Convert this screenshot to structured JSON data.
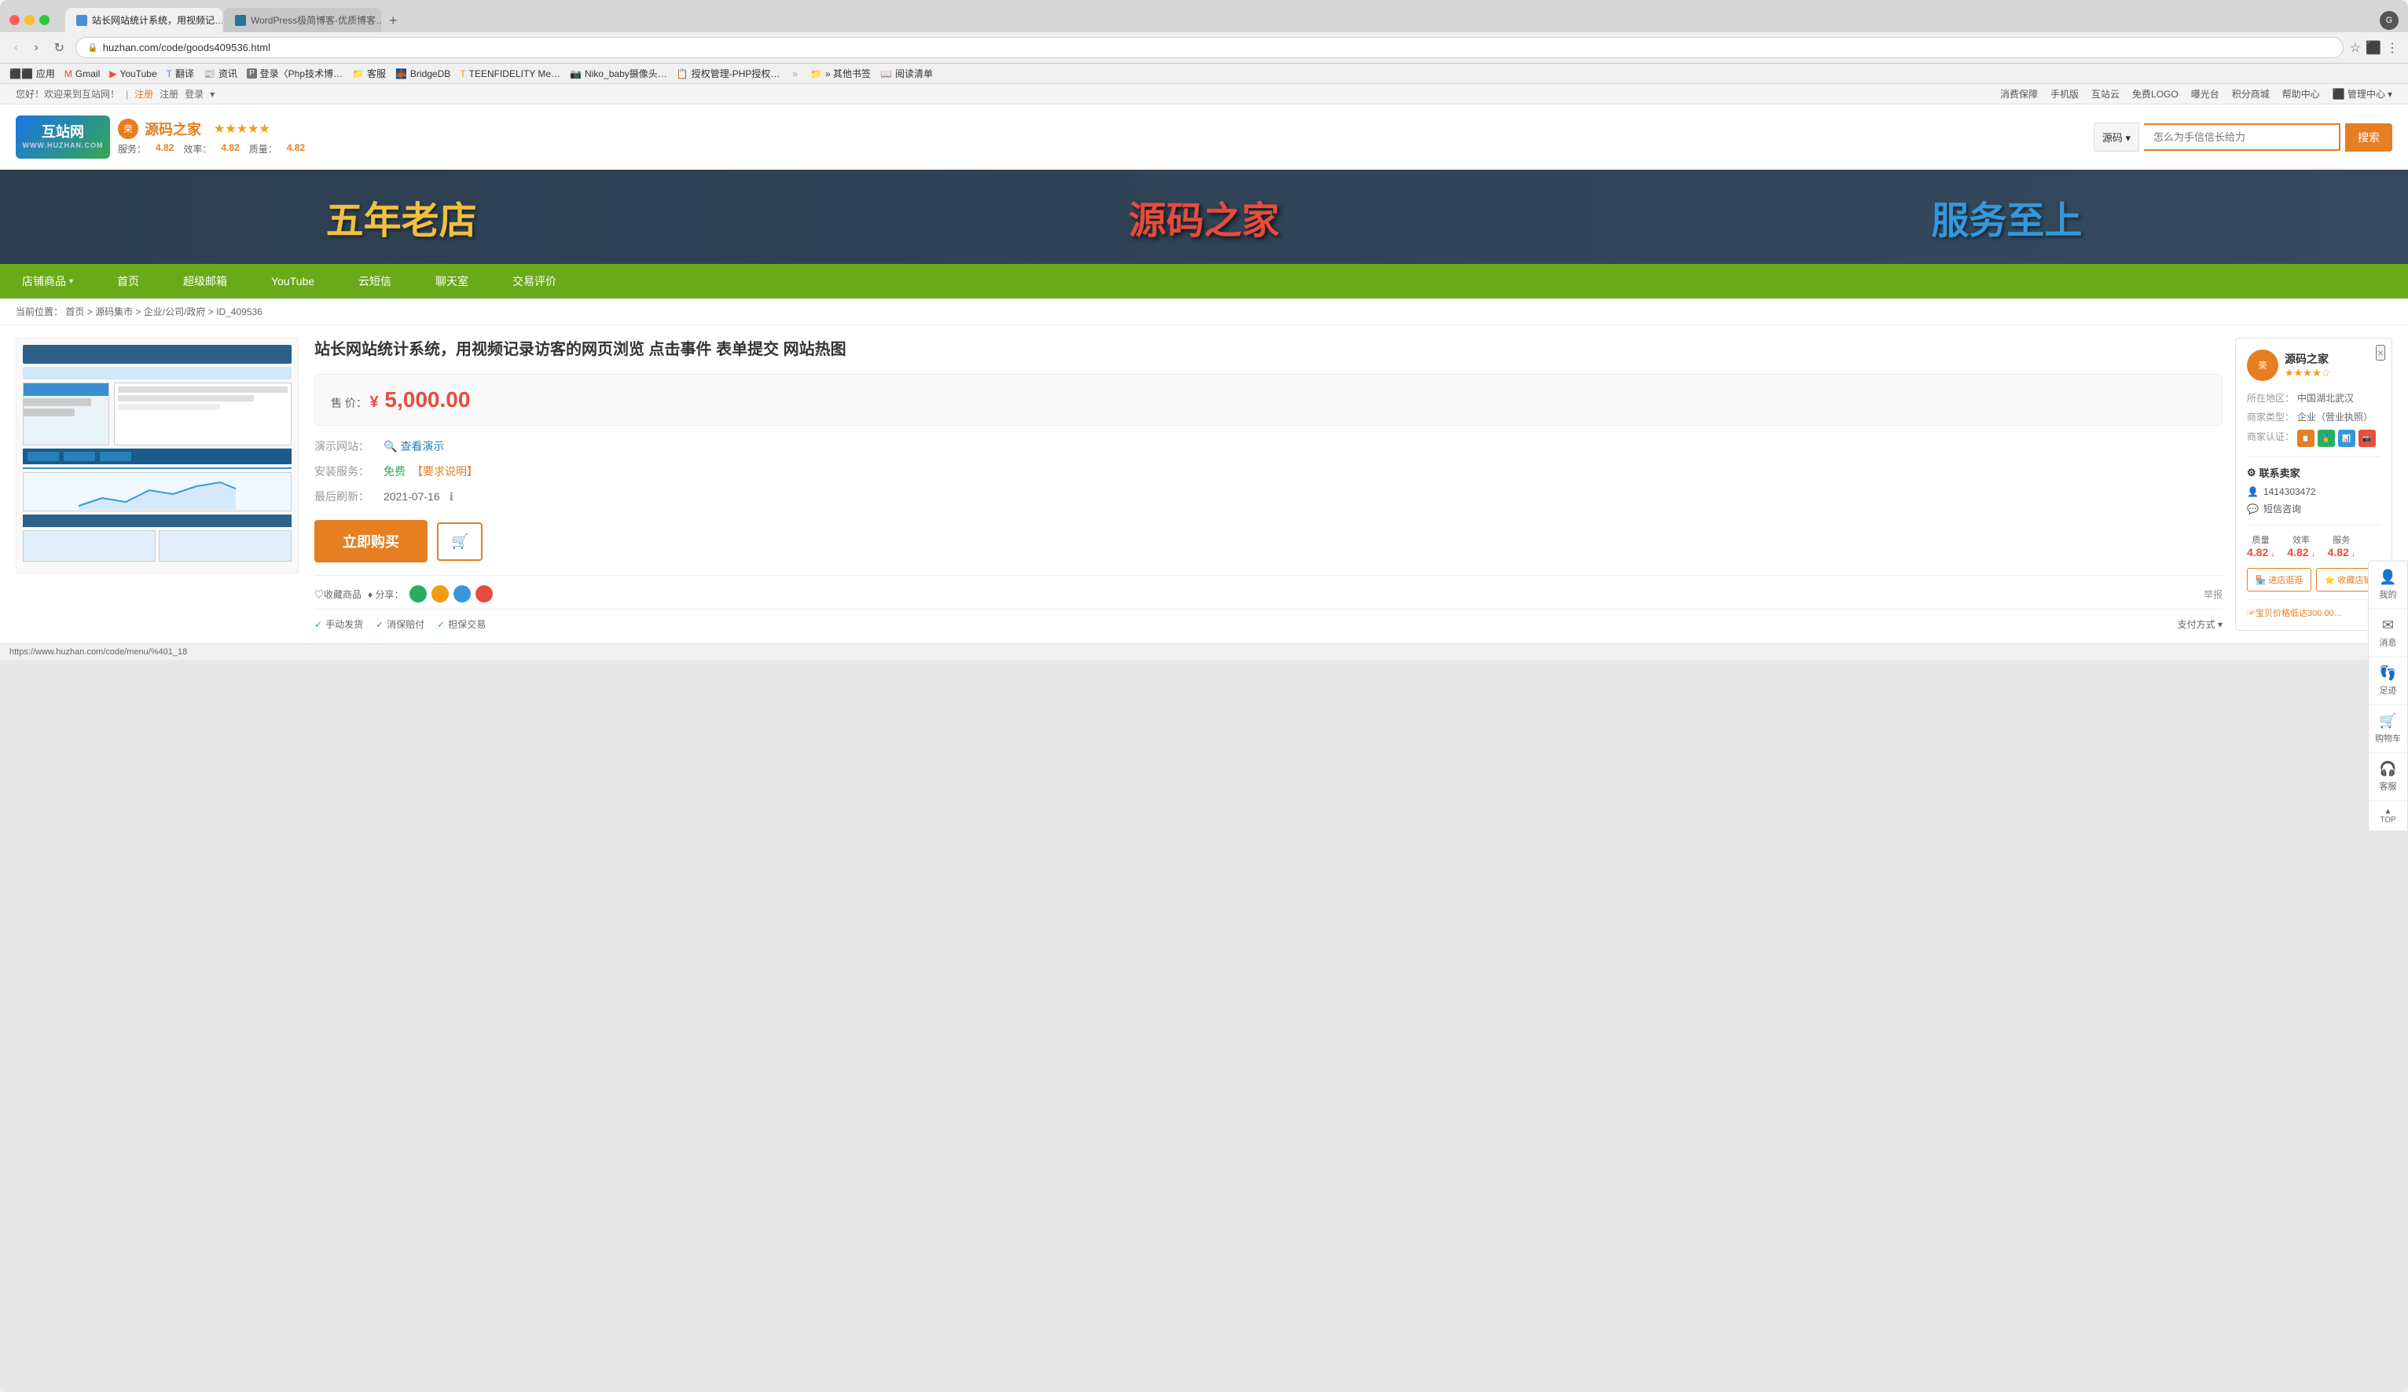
{
  "browser": {
    "tabs": [
      {
        "id": "tab1",
        "label": "站长网站统计系统，用视频记…",
        "icon_color": "#4a90d9",
        "active": true,
        "close_label": "×"
      },
      {
        "id": "tab2",
        "label": "WordPress极简博客-优质博客…",
        "icon_color": "#21759b",
        "active": false,
        "close_label": "×"
      }
    ],
    "new_tab_label": "+",
    "address": "huzhan.com/code/goods409536.html",
    "lock_icon": "🔒",
    "back_btn": "‹",
    "forward_btn": "›",
    "close_btn": "✕",
    "reload_btn": "↻",
    "star_btn": "☆",
    "more_btn": "⋮"
  },
  "bookmarks": [
    {
      "label": "应用",
      "icon": "⬛"
    },
    {
      "label": "Gmail",
      "icon": "M"
    },
    {
      "label": "YouTube",
      "icon": "▶"
    },
    {
      "label": "翻译",
      "icon": "T"
    },
    {
      "label": "资讯",
      "icon": "📰"
    },
    {
      "label": "登录〈Php技术博…",
      "icon": "P"
    },
    {
      "label": "客服",
      "icon": "💬"
    },
    {
      "label": "BridgeDB",
      "icon": "B"
    },
    {
      "label": "TEENFIDELITY Me…",
      "icon": "T"
    },
    {
      "label": "Niko_baby摄像头…",
      "icon": "N"
    },
    {
      "label": "授权管理-PHP授权…",
      "icon": "📋"
    },
    {
      "label": "» 其他书签",
      "icon": "📁"
    },
    {
      "label": "阅读清单",
      "icon": "📖"
    }
  ],
  "site": {
    "topbar": {
      "welcome": "您好！欢迎来到互站网！",
      "register": "注册",
      "login": "登录",
      "login_arrow": "▾",
      "links": [
        "消费保障",
        "手机版",
        "互站云",
        "免费LOGO",
        "曝光台",
        "积分商城",
        "帮助中心"
      ],
      "admin": "管理中心",
      "admin_arrow": "▾"
    },
    "header": {
      "logo_text": "互站网\nWWW.HUZHAN.COM",
      "seller_badge": "荣",
      "seller_name": "源码之家",
      "stars": "★★★★★",
      "rating_service_label": "服务：",
      "rating_service": "4.82",
      "rating_efficiency_label": "效率：",
      "rating_efficiency": "4.82",
      "rating_quality_label": "质量：",
      "rating_quality": "4.82",
      "search_category": "源码",
      "search_category_arrow": "▾",
      "search_placeholder": "怎么为手信信长给力",
      "search_btn": "搜索"
    },
    "banner": {
      "part1": "五年老店",
      "part2": "源码之家",
      "part3": "服务至上"
    },
    "nav": {
      "items": [
        {
          "label": "店铺商品",
          "has_dropdown": true
        },
        {
          "label": "首页",
          "has_dropdown": false
        },
        {
          "label": "超级邮箱",
          "has_dropdown": false
        },
        {
          "label": "YouTube",
          "has_dropdown": false
        },
        {
          "label": "云短信",
          "has_dropdown": false
        },
        {
          "label": "聊天室",
          "has_dropdown": false
        },
        {
          "label": "交易评价",
          "has_dropdown": false
        }
      ]
    },
    "breadcrumb": {
      "prefix": "当前位置：",
      "items": [
        "首页",
        "源码集市",
        "企业/公司/政府",
        "ID_409536"
      ],
      "separators": [
        ">",
        ">",
        ">"
      ]
    },
    "product": {
      "title": "站长网站统计系统，用视频记录访客的网页浏览 点击事件 表单提交 网站热图",
      "price_label": "售 价：",
      "price": "¥ 5,000.00",
      "demo_label": "演示网站：",
      "demo_link": "查看演示",
      "install_label": "安装服务：",
      "install_free": "免费",
      "install_link": "【要求说明】",
      "update_label": "最后刷新：",
      "update_date": "2021-07-16",
      "update_icon": "ℹ",
      "buy_btn": "立即购买",
      "cart_icon": "🛒",
      "collect": "♡收藏商品",
      "share_label": "♦ 分享：",
      "report": "举报",
      "guarantees": [
        {
          "label": "手动发货",
          "checked": true
        },
        {
          "label": "消保赔付",
          "checked": true
        },
        {
          "label": "担保交易",
          "checked": true
        }
      ],
      "payment_label": "支付方式",
      "payment_arrow": "▾"
    },
    "seller_card": {
      "avatar_text": "荣",
      "name": "源码之家",
      "stars": "★★★★☆",
      "location_label": "所在地区：",
      "location": "中国湖北武汉",
      "type_label": "商家类型：",
      "type": "企业（营业执照）",
      "cert_label": "商家认证：",
      "certs": [
        "📋",
        "🏅",
        "📊",
        "📷"
      ],
      "contact_title": "联系卖家",
      "contact_phone": "1414303472",
      "contact_sms": "短信咨询",
      "ratings": [
        {
          "label": "质量",
          "value": "4.82",
          "arrow": "↓"
        },
        {
          "label": "效率",
          "value": "4.82",
          "arrow": "↓"
        },
        {
          "label": "服务",
          "value": "4.82",
          "arrow": "↓"
        }
      ],
      "btn_shop": "进店逛逛",
      "btn_collect": "收藏店铺",
      "close_btn": "×",
      "promo_text": "☞宝贝价格低达300.00…"
    },
    "right_float": {
      "items": [
        {
          "label": "我的",
          "icon": "👤"
        },
        {
          "label": "消息",
          "icon": "✉"
        },
        {
          "label": "足迹",
          "icon": "👣"
        },
        {
          "label": "购物车",
          "icon": "🛒"
        }
      ],
      "customer_service": "客服",
      "top_label": "TOP"
    }
  },
  "status_bar": {
    "url": "https://www.huzhan.com/code/menu/%401_18"
  }
}
